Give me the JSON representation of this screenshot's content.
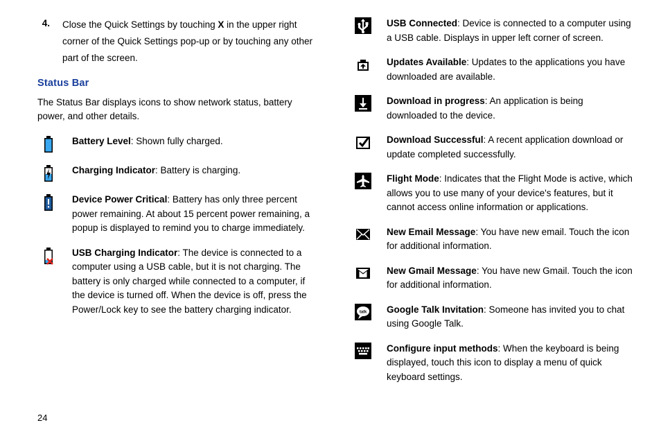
{
  "step": {
    "num": "4.",
    "pre": "Close the Quick Settings by touching ",
    "bold": "X",
    "post": " in the upper right corner of the Quick Settings pop-up or by touching any other part of the screen."
  },
  "heading": "Status Bar",
  "intro": "The Status Bar displays icons to show network status, battery power, and other details.",
  "left": [
    {
      "title": "Battery Level",
      "desc": ": Shown fully charged.",
      "icon": "battery-full-icon"
    },
    {
      "title": "Charging Indicator",
      "desc": ": Battery is charging.",
      "icon": "battery-charging-icon"
    },
    {
      "title": "Device Power Critical",
      "desc": ": Battery has only three percent power remaining. At about 15 percent power remaining, a popup is displayed to remind you to charge immediately.",
      "icon": "battery-critical-icon"
    },
    {
      "title": "USB Charging Indicator",
      "desc": ": The device is connected to a computer using a USB cable, but it is not charging. The battery is only charged while connected to a computer, if the device is turned off. When the device is off, press the Power/Lock key to see the battery charging indicator.",
      "icon": "usb-charging-icon"
    }
  ],
  "right": [
    {
      "title": "USB Connected",
      "desc": ": Device is connected to a computer using a USB cable. Displays in upper left corner of screen.",
      "icon": "usb-icon"
    },
    {
      "title": "Updates Available",
      "desc": ": Updates to the applications you have downloaded are available.",
      "icon": "updates-available-icon"
    },
    {
      "title": "Download in progress",
      "desc": ": An application is being downloaded to the device.",
      "icon": "download-progress-icon"
    },
    {
      "title": "Download Successful",
      "desc": ": A recent application download or update completed successfully.",
      "icon": "download-success-icon"
    },
    {
      "title": "Flight Mode",
      "desc": ": Indicates that the Flight Mode is active, which allows you to use many of your device's features, but it cannot access online information or applications.",
      "icon": "flight-mode-icon"
    },
    {
      "title": "New Email Message",
      "desc": ": You have new email. Touch the icon for additional information.",
      "icon": "email-icon"
    },
    {
      "title": "New Gmail Message",
      "desc": ": You have new Gmail. Touch the icon for additional information.",
      "icon": "gmail-icon"
    },
    {
      "title": "Google Talk Invitation",
      "desc": ": Someone has invited you to chat using Google Talk.",
      "icon": "google-talk-icon"
    },
    {
      "title": "Configure input methods",
      "desc": ": When the keyboard is being displayed, touch this icon to display a menu of quick keyboard settings.",
      "icon": "keyboard-icon"
    }
  ],
  "pageNumber": "24"
}
